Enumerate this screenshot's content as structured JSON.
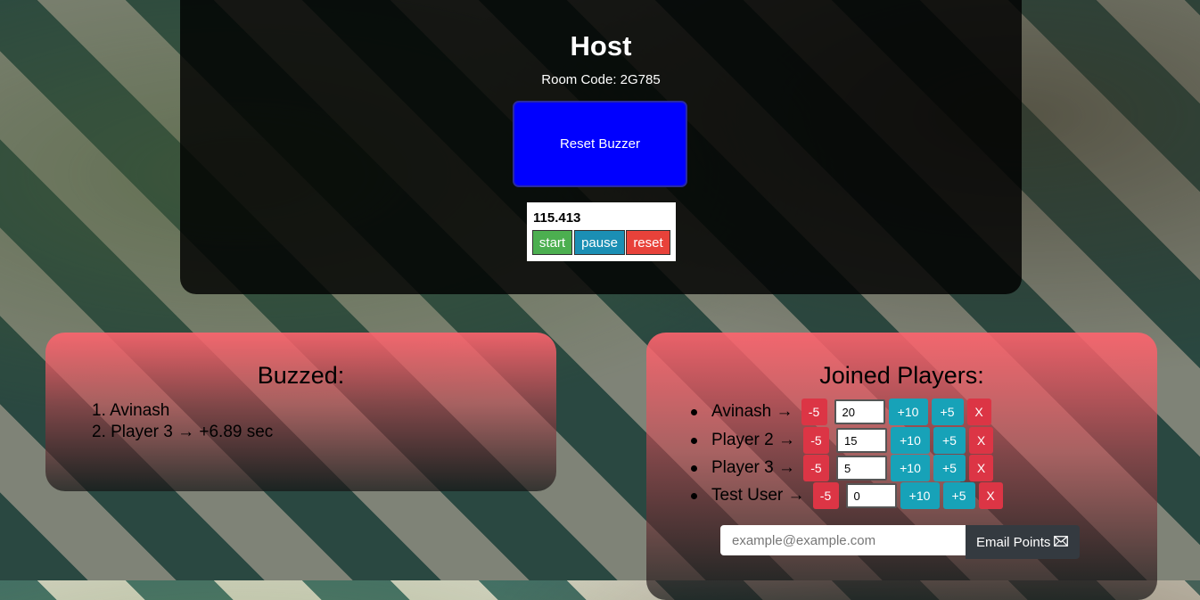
{
  "host": {
    "title": "Host",
    "room_code": "Room Code: 2G785",
    "reset_buzzer_label": "Reset Buzzer"
  },
  "stopwatch": {
    "time": "115.413",
    "start_label": "start",
    "pause_label": "pause",
    "reset_label": "reset"
  },
  "buzzed": {
    "title": "Buzzed:",
    "items": [
      "1. Avinash",
      "2. Player 3 → +6.89 sec"
    ]
  },
  "players": {
    "title": "Joined Players:",
    "list": [
      {
        "name": "Avinash →",
        "score": "20"
      },
      {
        "name": "Player 2 →",
        "score": "15"
      },
      {
        "name": "Player 3 →",
        "score": "5"
      },
      {
        "name": "Test User →",
        "score": "0"
      }
    ],
    "minus_label": "-5",
    "plus10_label": "+10",
    "plus5_label": "+5",
    "remove_label": "X"
  },
  "email": {
    "placeholder": "example@example.com",
    "button_label": "Email Points",
    "button_icon": "envelope-icon"
  },
  "colors": {
    "reset_buzzer": "#0000ff",
    "start": "#4caf50",
    "pause": "#1b8fb4",
    "reset": "#e8423a",
    "danger": "#dc3545",
    "info": "#17a2b8",
    "dark": "#343a40"
  }
}
